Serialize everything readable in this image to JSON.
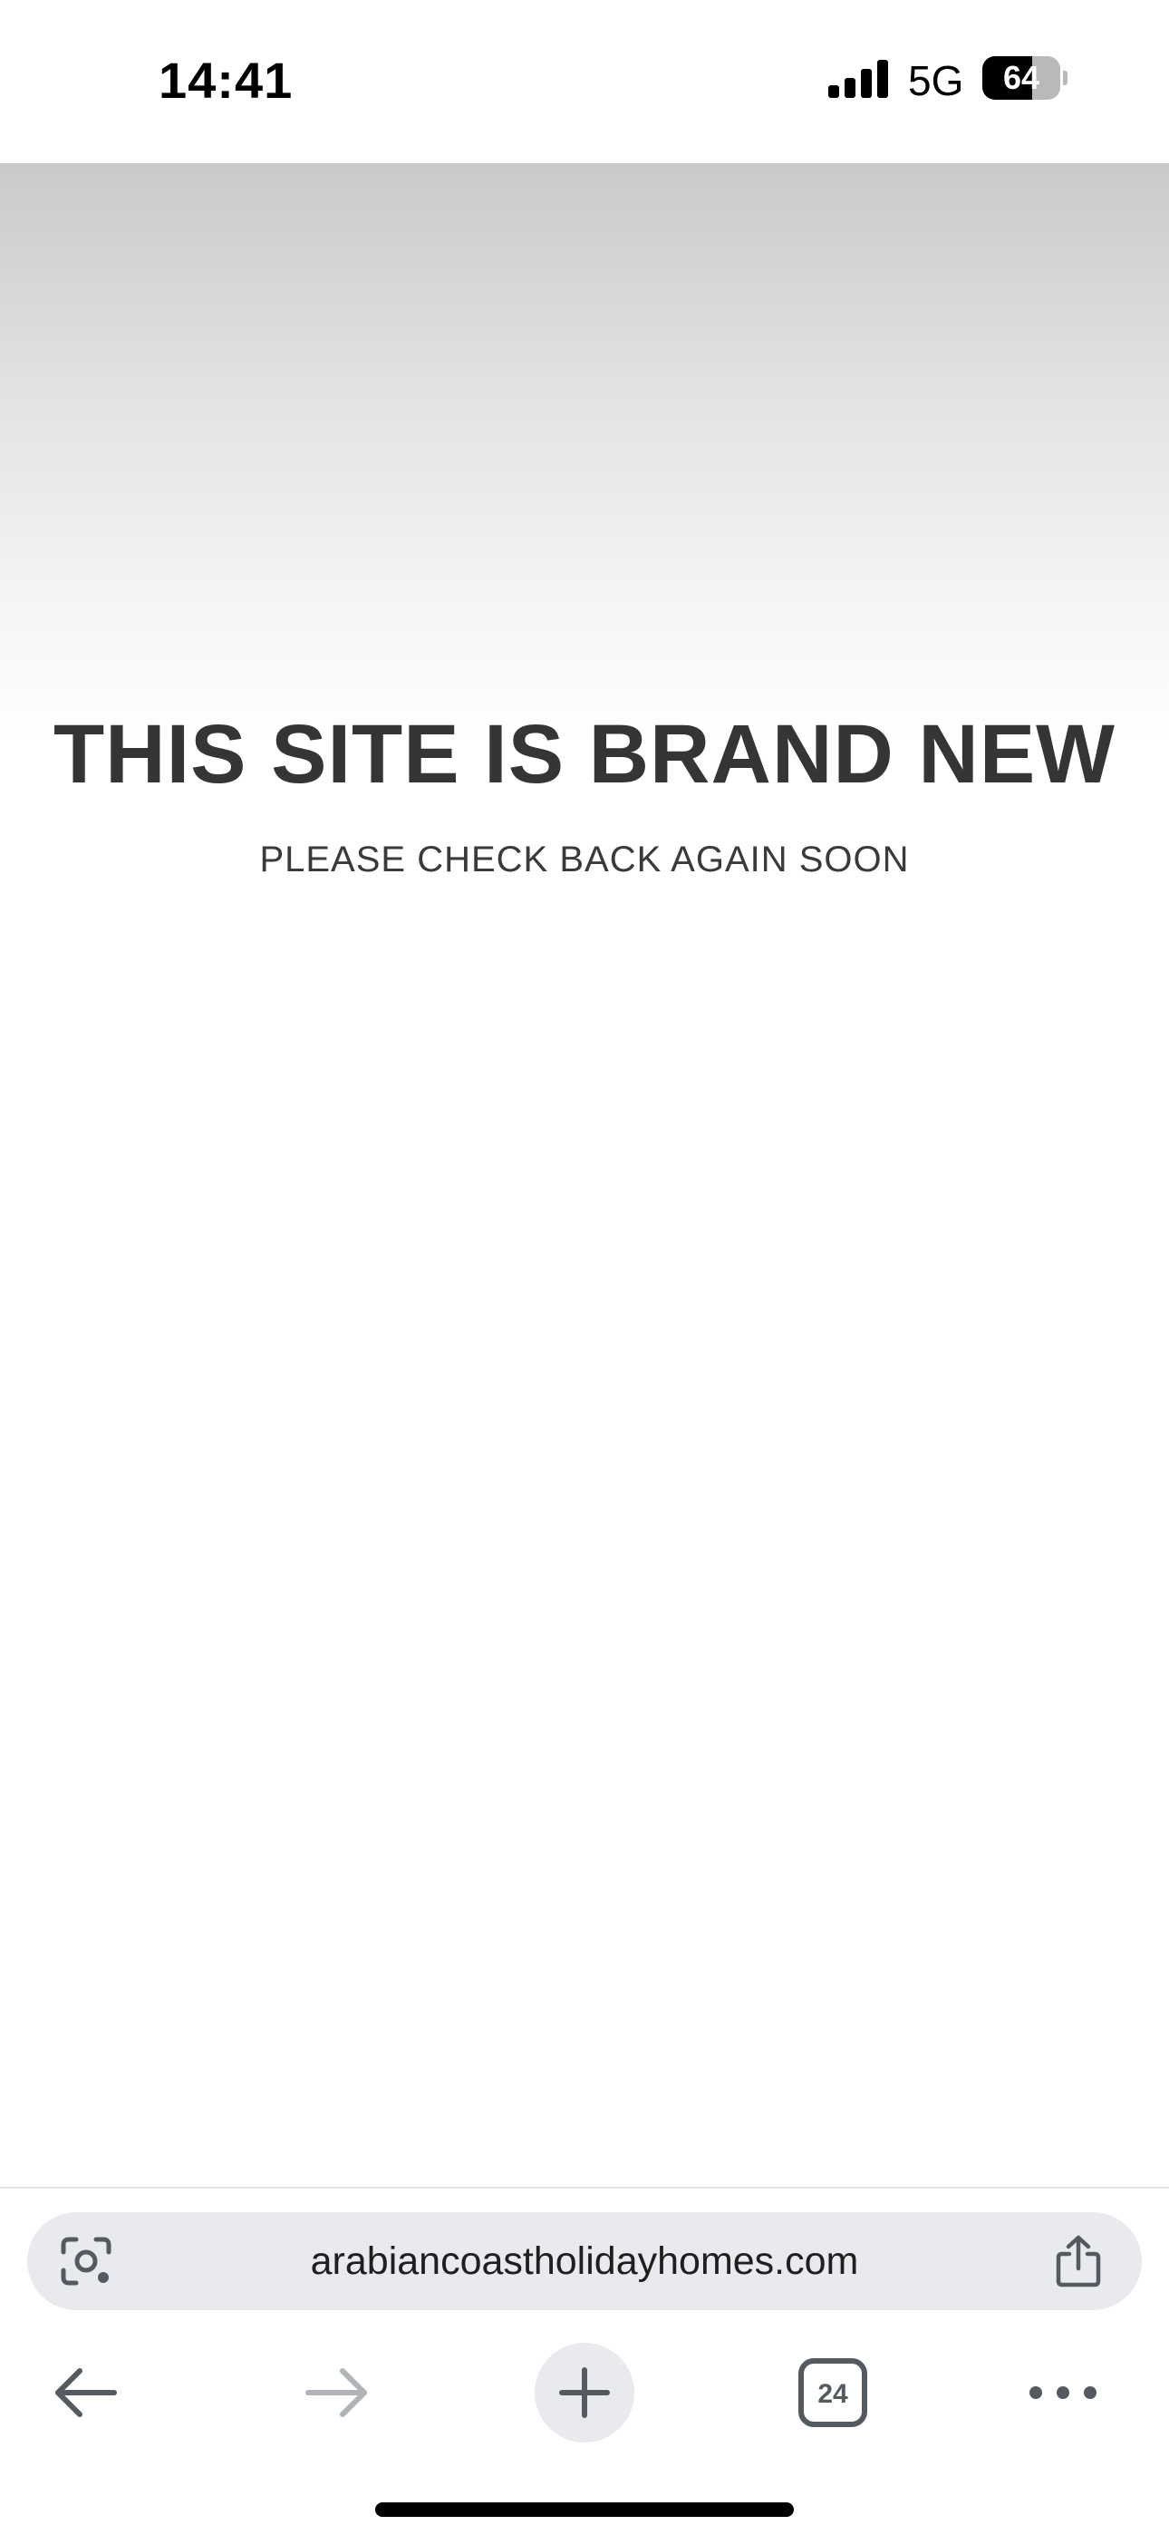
{
  "status_bar": {
    "time": "14:41",
    "network": "5G",
    "battery_level": "64",
    "battery_fraction": 0.64,
    "signal_icon": "signal-bars-icon"
  },
  "page": {
    "title": "THIS SITE IS BRAND NEW",
    "subtitle": "PLEASE CHECK BACK AGAIN SOON",
    "text_color": "#353535"
  },
  "browser": {
    "url": "arabiancoastholidayhomes.com",
    "tab_count": "24",
    "icons": {
      "lens": "lens-icon",
      "share": "share-icon",
      "back": "back-arrow-icon",
      "forward": "forward-arrow-icon",
      "new_tab": "plus-icon",
      "tabs": "tab-switcher-icon",
      "menu": "more-dots-icon"
    },
    "chrome_background": "#e8eaed",
    "icon_color": "#555a60",
    "disabled_icon_color": "#b0b3b8"
  }
}
